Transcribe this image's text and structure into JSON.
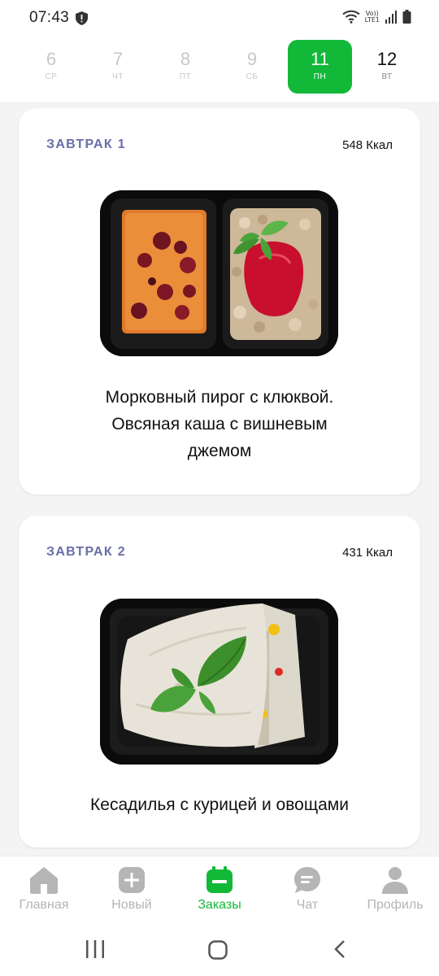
{
  "status_bar": {
    "time": "07:43",
    "network_top": "Vo))",
    "network_bottom": "LTE1"
  },
  "days": [
    {
      "num": "6",
      "weekday": "СР",
      "state": "past"
    },
    {
      "num": "7",
      "weekday": "ЧТ",
      "state": "past"
    },
    {
      "num": "8",
      "weekday": "ПТ",
      "state": "past"
    },
    {
      "num": "9",
      "weekday": "СБ",
      "state": "past"
    },
    {
      "num": "11",
      "weekday": "ПН",
      "state": "active"
    },
    {
      "num": "12",
      "weekday": "ВТ",
      "state": "future"
    }
  ],
  "meals": [
    {
      "meal": "ЗАВТРАК 1",
      "kcal": "548 Ккал",
      "title_lines": [
        "Морковный пирог с клюквой.",
        "Овсяная каша с вишневым",
        "джемом"
      ],
      "image_icon": "meal-photo-carrot-pie-oatmeal"
    },
    {
      "meal": "ЗАВТРАК 2",
      "kcal": "431 Ккал",
      "title_lines": [
        "Кесадилья с курицей и овощами"
      ],
      "image_icon": "meal-photo-quesadilla"
    }
  ],
  "bottom_nav": [
    {
      "label": "Главная",
      "icon": "home-icon"
    },
    {
      "label": "Новый",
      "icon": "plus-icon"
    },
    {
      "label": "Заказы",
      "icon": "calendar-icon",
      "active": true
    },
    {
      "label": "Чат",
      "icon": "chat-icon"
    },
    {
      "label": "Профиль",
      "icon": "profile-icon"
    }
  ],
  "colors": {
    "accent": "#12b938",
    "meal_label": "#6a6ea8",
    "inactive_nav": "#b5b5b5"
  }
}
